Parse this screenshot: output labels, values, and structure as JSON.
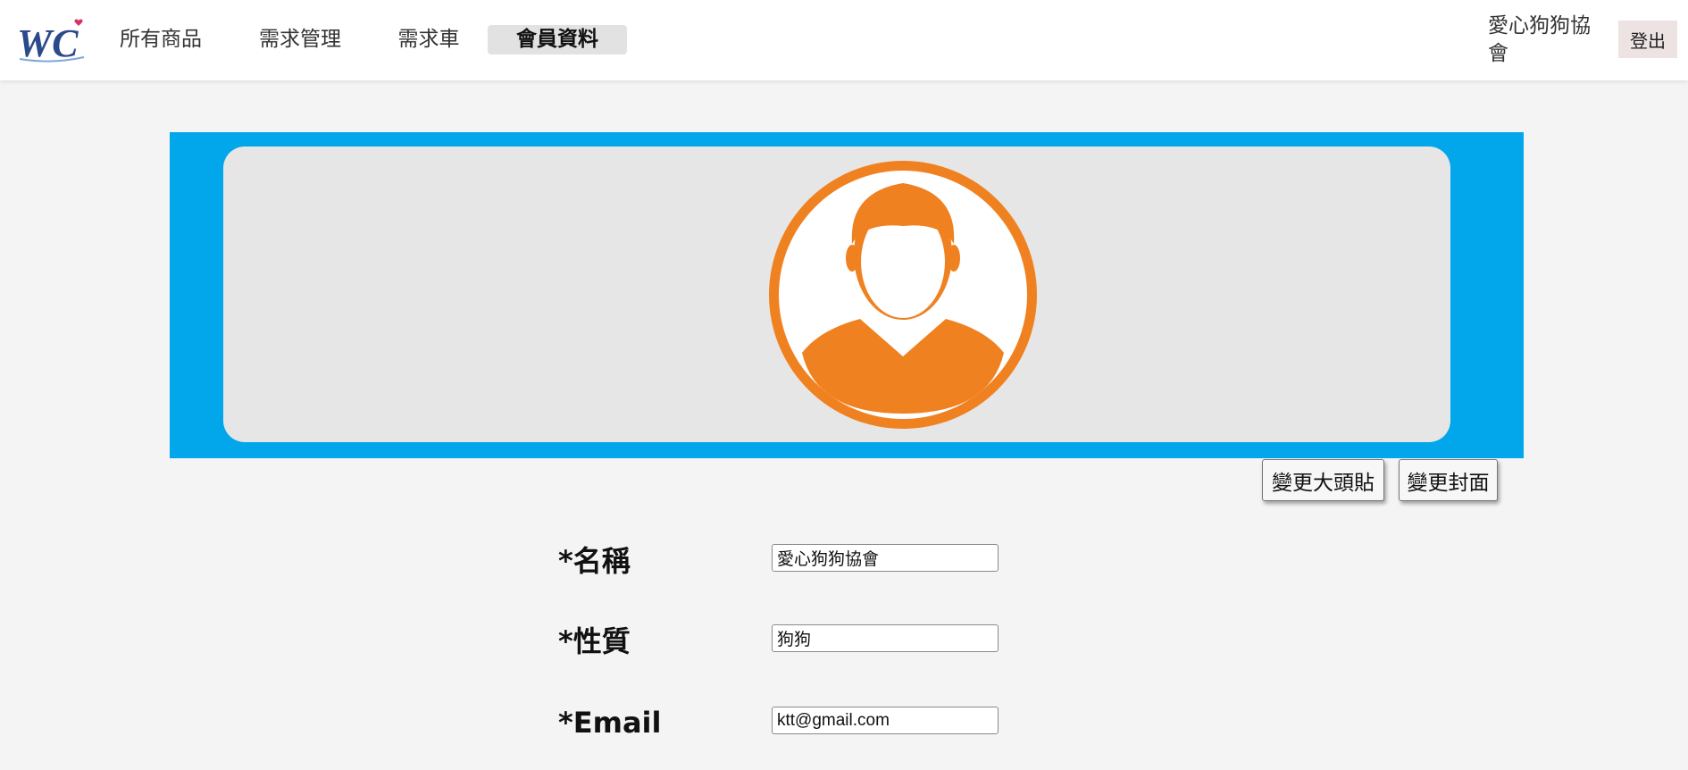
{
  "header": {
    "logo_text": "WC",
    "nav": [
      {
        "label": "所有商品",
        "active": false
      },
      {
        "label": "需求管理",
        "active": false
      },
      {
        "label": "需求車",
        "active": false
      },
      {
        "label": "會員資料",
        "active": true
      }
    ],
    "user_name": "愛心狗狗協會",
    "logout_label": "登出"
  },
  "banner": {
    "avatar_icon": "user-avatar-icon",
    "change_avatar_label": "變更大頭貼",
    "change_cover_label": "變更封面"
  },
  "form": {
    "fields": [
      {
        "label": "*名稱",
        "value": "愛心狗狗協會"
      },
      {
        "label": "*性質",
        "value": "狗狗"
      },
      {
        "label": "*Email",
        "value": "ktt@gmail.com"
      }
    ]
  },
  "colors": {
    "banner_bg": "#02a6ea",
    "avatar_orange": "#f08120",
    "cover_bg": "#e6e6e6",
    "logo_blue": "#2b4a8c",
    "logo_heart": "#d6336c"
  }
}
